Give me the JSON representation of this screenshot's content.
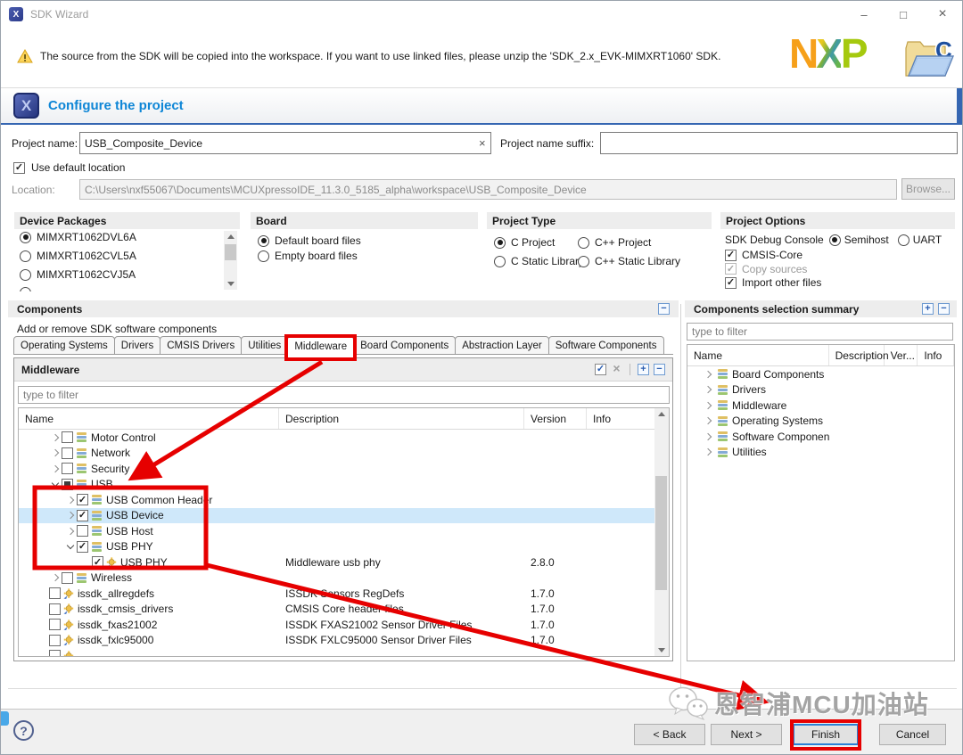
{
  "titlebar": {
    "title": "SDK Wizard"
  },
  "icons": {
    "minimize": "–",
    "maximize": "□",
    "close": "×",
    "clear_field": "×",
    "help": "?",
    "app_letter": "X",
    "folder_letter": "C",
    "plus": "+",
    "minus": "−",
    "check": "✓",
    "clear_all": "×"
  },
  "notice": {
    "text": "The source from the SDK will be copied into the workspace. If you want to use linked files, please unzip the 'SDK_2.x_EVK-MIMXRT1060' SDK."
  },
  "brand": {
    "letters": [
      "N",
      "X",
      "P"
    ]
  },
  "banner": {
    "title": "Configure the project"
  },
  "form": {
    "project_name_label": "Project name:",
    "project_name_value": "USB_Composite_Device",
    "suffix_label": "Project name suffix:",
    "suffix_value": "",
    "use_default_location_label": "Use default location",
    "location_label": "Location:",
    "location_value": "C:\\Users\\nxf55067\\Documents\\MCUXpressoIDE_11.3.0_5185_alpha\\workspace\\USB_Composite_Device",
    "browse_label": "Browse..."
  },
  "groups": {
    "device_packages": {
      "title": "Device Packages",
      "items": [
        {
          "label": "MIMXRT1062DVL6A",
          "selected": true
        },
        {
          "label": "MIMXRT1062CVL5A",
          "selected": false
        },
        {
          "label": "MIMXRT1062CVJ5A",
          "selected": false
        },
        {
          "label": "",
          "selected": false
        }
      ]
    },
    "board": {
      "title": "Board",
      "items": [
        {
          "label": "Default board files",
          "selected": true
        },
        {
          "label": "Empty board files",
          "selected": false
        }
      ]
    },
    "project_type": {
      "title": "Project Type",
      "items": [
        {
          "label": "C Project",
          "selected": true
        },
        {
          "label": "C++ Project",
          "selected": false
        },
        {
          "label": "C Static Library",
          "selected": false
        },
        {
          "label": "C++ Static Library",
          "selected": false
        }
      ]
    },
    "project_options": {
      "title": "Project Options",
      "debug_console_label": "SDK Debug Console",
      "debug_console_options": [
        {
          "label": "Semihost",
          "selected": true
        },
        {
          "label": "UART",
          "selected": false
        }
      ],
      "checkboxes": [
        {
          "label": "CMSIS-Core",
          "checked": true,
          "disabled": false
        },
        {
          "label": "Copy sources",
          "checked": true,
          "disabled": true
        },
        {
          "label": "Import other files",
          "checked": true,
          "disabled": false
        }
      ]
    }
  },
  "components": {
    "title": "Components",
    "subtitle": "Add or remove SDK software components",
    "tabs": [
      "Operating Systems",
      "Drivers",
      "CMSIS Drivers",
      "Utilities",
      "Middleware",
      "Board Components",
      "Abstraction Layer",
      "Software Components"
    ],
    "active_tab": "Middleware",
    "panel": {
      "title": "Middleware",
      "filter_placeholder": "type to filter",
      "columns": [
        "Name",
        "Description",
        "Version",
        "Info"
      ],
      "rows": [
        {
          "name": "Motor Control",
          "desc": "",
          "version": "",
          "level": 0,
          "expander": "collapsed",
          "check": "off",
          "icon": "layers",
          "highlight": false,
          "clipped": false
        },
        {
          "name": "Network",
          "desc": "",
          "version": "",
          "level": 0,
          "expander": "collapsed",
          "check": "off",
          "icon": "layers",
          "highlight": false,
          "clipped": false
        },
        {
          "name": "Security",
          "desc": "",
          "version": "",
          "level": 0,
          "expander": "collapsed",
          "check": "off",
          "icon": "layers",
          "highlight": false,
          "clipped": false
        },
        {
          "name": "USB",
          "desc": "",
          "version": "",
          "level": 0,
          "expander": "expanded",
          "check": "partial",
          "icon": "layers",
          "highlight": false,
          "clipped": false
        },
        {
          "name": "USB Common Header",
          "desc": "",
          "version": "",
          "level": 1,
          "expander": "collapsed",
          "check": "on",
          "icon": "layers",
          "highlight": false,
          "clipped": false
        },
        {
          "name": "USB Device",
          "desc": "",
          "version": "",
          "level": 1,
          "expander": "collapsed",
          "check": "on",
          "icon": "layers",
          "highlight": true,
          "clipped": false
        },
        {
          "name": "USB Host",
          "desc": "",
          "version": "",
          "level": 1,
          "expander": "collapsed",
          "check": "off",
          "icon": "layers",
          "highlight": false,
          "clipped": false
        },
        {
          "name": "USB PHY",
          "desc": "",
          "version": "",
          "level": 1,
          "expander": "expanded",
          "check": "on",
          "icon": "layers",
          "highlight": false,
          "clipped": false
        },
        {
          "name": "USB PHY",
          "desc": "Middleware usb phy",
          "version": "2.8.0",
          "level": 2,
          "expander": "none",
          "check": "on",
          "icon": "plugin",
          "highlight": false,
          "clipped": false
        },
        {
          "name": "Wireless",
          "desc": "",
          "version": "",
          "level": 0,
          "expander": "collapsed",
          "check": "off",
          "icon": "layers",
          "highlight": false,
          "clipped": false
        },
        {
          "name": "issdk_allregdefs",
          "desc": "ISSDK Sensors RegDefs",
          "version": "1.7.0",
          "level": 0,
          "expander": "none",
          "check": "off",
          "icon": "plugin",
          "highlight": false,
          "clipped": false
        },
        {
          "name": "issdk_cmsis_drivers",
          "desc": "CMSIS Core header files",
          "version": "1.7.0",
          "level": 0,
          "expander": "none",
          "check": "off",
          "icon": "plugin",
          "highlight": false,
          "clipped": false
        },
        {
          "name": "issdk_fxas21002",
          "desc": "ISSDK FXAS21002 Sensor Driver Files",
          "version": "1.7.0",
          "level": 0,
          "expander": "none",
          "check": "off",
          "icon": "plugin",
          "highlight": false,
          "clipped": false
        },
        {
          "name": "issdk_fxlc95000",
          "desc": "ISSDK FXLC95000 Sensor Driver Files",
          "version": "1.7.0",
          "level": 0,
          "expander": "none",
          "check": "off",
          "icon": "plugin",
          "highlight": false,
          "clipped": false
        },
        {
          "name": "",
          "desc": "",
          "version": "",
          "level": 0,
          "expander": "none",
          "check": "off",
          "icon": "plugin",
          "highlight": false,
          "clipped": true
        }
      ]
    }
  },
  "summary": {
    "title": "Components selection summary",
    "filter_placeholder": "type to filter",
    "columns": [
      "Name",
      "Description",
      "Ver...",
      "Info"
    ],
    "rows": [
      {
        "name": "Board Components"
      },
      {
        "name": "Drivers"
      },
      {
        "name": "Middleware"
      },
      {
        "name": "Operating Systems"
      },
      {
        "name": "Software Componen"
      },
      {
        "name": "Utilities"
      }
    ]
  },
  "footer": {
    "back": "< Back",
    "next": "Next >",
    "finish": "Finish",
    "cancel": "Cancel"
  },
  "watermark": {
    "text": "恩智浦MCU加油站"
  }
}
